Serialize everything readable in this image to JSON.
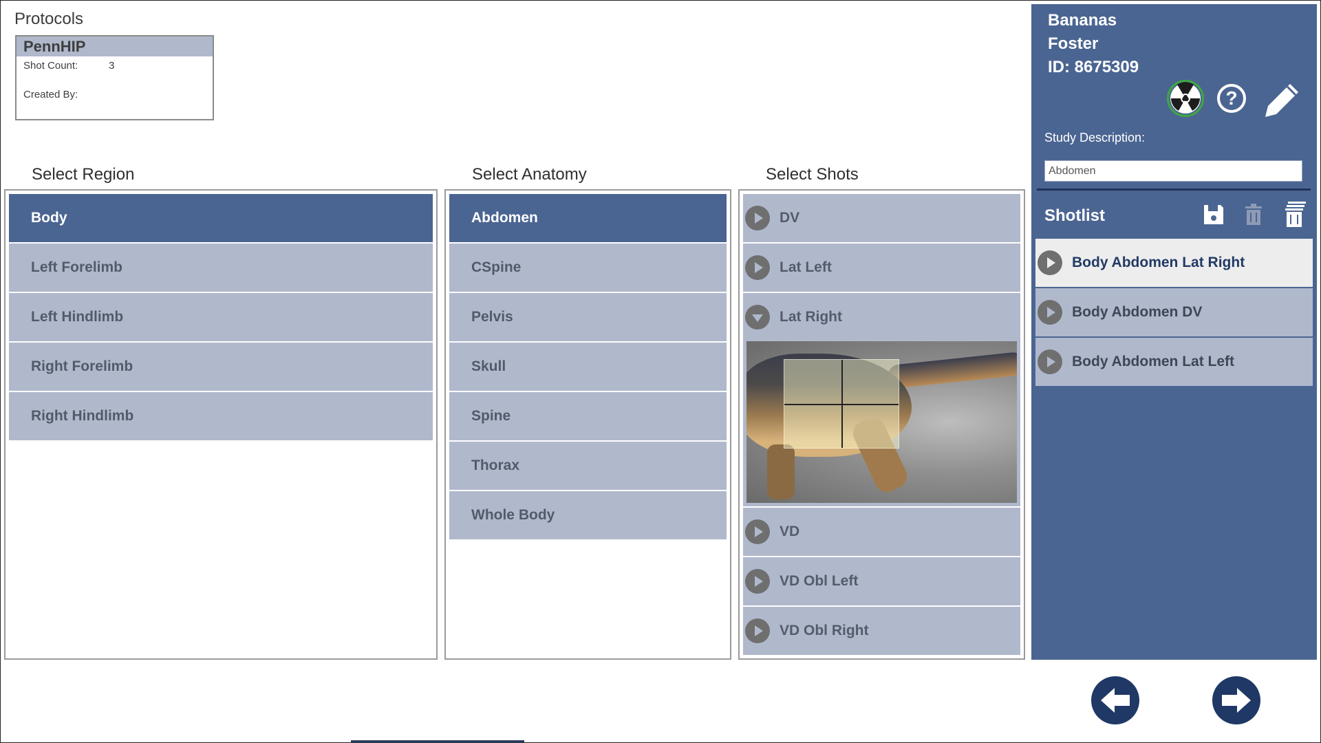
{
  "protocols": {
    "label": "Protocols",
    "card": {
      "name": "PennHIP",
      "shot_count_label": "Shot Count:",
      "shot_count_value": "3",
      "created_by_label": "Created By:",
      "created_by_value": ""
    }
  },
  "region": {
    "title": "Select Region",
    "items": [
      "Body",
      "Left Forelimb",
      "Left Hindlimb",
      "Right Forelimb",
      "Right Hindlimb"
    ],
    "selected": "Body"
  },
  "anatomy": {
    "title": "Select Anatomy",
    "items": [
      "Abdomen",
      "CSpine",
      "Pelvis",
      "Skull",
      "Spine",
      "Thorax",
      "Whole Body"
    ],
    "selected": "Abdomen"
  },
  "shots": {
    "title": "Select Shots",
    "items": [
      "DV",
      "Lat Left",
      "Lat Right",
      "VD",
      "VD Obl Left",
      "VD Obl Right"
    ],
    "expanded": "Lat Right"
  },
  "patient": {
    "first_name": "Bananas",
    "last_name": "Foster",
    "id_text": "ID: 8675309"
  },
  "icons": {
    "radiation": "radiation-icon",
    "help": "help-icon",
    "help_glyph": "?",
    "edit": "pencil-icon",
    "save": "save-icon",
    "delete": "trash-icon",
    "delete_all": "trash-all-icon",
    "back": "arrow-left-icon",
    "next": "arrow-right-icon"
  },
  "study": {
    "label": "Study Description:",
    "value": "Abdomen"
  },
  "shotlist": {
    "title": "Shotlist",
    "items": [
      "Body Abdomen Lat Right",
      "Body Abdomen DV",
      "Body Abdomen Lat Left"
    ],
    "selected": "Body Abdomen Lat Right"
  },
  "colors": {
    "accent": "#4b6592",
    "item_bg": "#b0b8cc",
    "nav": "#1f3866",
    "radiation_ring": "#3fa83f"
  }
}
